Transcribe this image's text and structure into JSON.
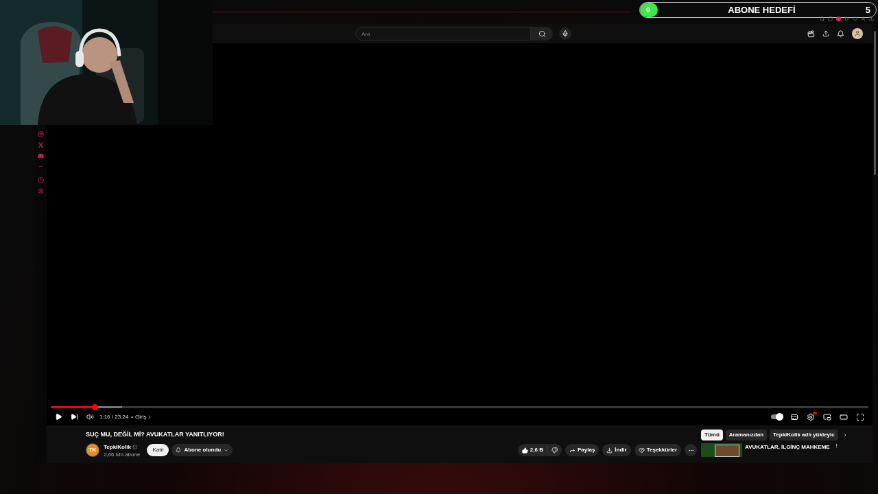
{
  "overlay": {
    "goal_label": "ABONE HEDEFİ",
    "current": "0",
    "target": "5",
    "level": 0
  },
  "search": {
    "placeholder": "Ara"
  },
  "player": {
    "level": 0.054,
    "buffer": {
      "level": 0.087
    },
    "time": "1:16 / 23:24",
    "separator": "•",
    "chapter": "Giriş",
    "autoplay": true
  },
  "video": {
    "title": "SUÇ MU, DEĞİL Mİ? AVUKATLAR YANITLIYOR!",
    "channel": "TepkiKolik",
    "avatar": "TK",
    "verified": true,
    "subscribers": "2,66 Mn abone",
    "join": "Katıl",
    "subscribed": "Abone olundu",
    "likes": "2,6 B",
    "share": "Paylaş",
    "download": "İndir",
    "thanks": "Teşekkürler"
  },
  "chips": [
    {
      "label": "Tümü",
      "selected": true
    },
    {
      "label": "Aramanızdan",
      "selected": false
    },
    {
      "label": "TepkiKolik adlı yükleyic",
      "selected": false
    }
  ],
  "recommendation": {
    "title": "AVUKATLAR, İLGİNÇ MAHKEME"
  }
}
